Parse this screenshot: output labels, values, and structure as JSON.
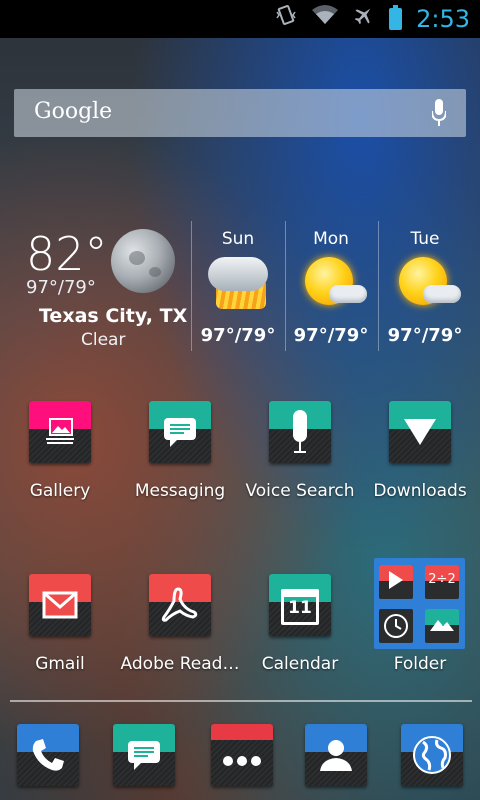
{
  "status_bar": {
    "time": "2:53",
    "icons": [
      "vibrate-icon",
      "wifi-icon",
      "airplane-icon",
      "battery-icon"
    ],
    "accent_color": "#33b5e5"
  },
  "search": {
    "logo_text": "Google",
    "mic_icon": "microphone-icon"
  },
  "weather": {
    "current_temp": "82°",
    "current_hilo": "97°/79°",
    "city": "Texas City, TX",
    "condition": "Clear",
    "current_icon": "moon-icon",
    "forecast": [
      {
        "day": "Sun",
        "hilo": "97°/79°",
        "icon": "thunderstorm-icon"
      },
      {
        "day": "Mon",
        "hilo": "97°/79°",
        "icon": "partly-cloudy-icon"
      },
      {
        "day": "Tue",
        "hilo": "97°/79°",
        "icon": "partly-cloudy-icon"
      }
    ]
  },
  "apps_row1": [
    {
      "label": "Gallery",
      "icon": "gallery-icon",
      "color": "#ff0f7b"
    },
    {
      "label": "Messaging",
      "icon": "message-bubble-icon",
      "color": "#1fb29b"
    },
    {
      "label": "Voice Search",
      "icon": "microphone-icon",
      "color": "#1fb29b"
    },
    {
      "label": "Downloads",
      "icon": "download-arrow-icon",
      "color": "#1fb29b"
    }
  ],
  "apps_row2": [
    {
      "label": "Gmail",
      "icon": "envelope-icon",
      "color": "#f04b4b"
    },
    {
      "label": "Adobe Read…",
      "icon": "acrobat-icon",
      "color": "#f04b4b"
    },
    {
      "label": "Calendar",
      "icon": "calendar-icon",
      "color": "#1fb29b",
      "date": "11"
    },
    {
      "label": "Folder",
      "icon": "folder-icon",
      "color": "#2f7fd6"
    }
  ],
  "folder_contents": [
    "play-store-icon",
    "calculator-icon",
    "clock-icon",
    "photo-editor-icon"
  ],
  "calculator_text": "2÷2",
  "dock": [
    {
      "name": "phone",
      "icon": "phone-handset-icon",
      "color": "#2f7fd6"
    },
    {
      "name": "messaging",
      "icon": "message-bubble-icon",
      "color": "#1fb29b"
    },
    {
      "name": "app-drawer",
      "icon": "app-drawer-dots-icon",
      "color": "#e83a44"
    },
    {
      "name": "people",
      "icon": "contact-person-icon",
      "color": "#2f7fd6"
    },
    {
      "name": "browser",
      "icon": "globe-icon",
      "color": "#2f7fd6"
    }
  ]
}
